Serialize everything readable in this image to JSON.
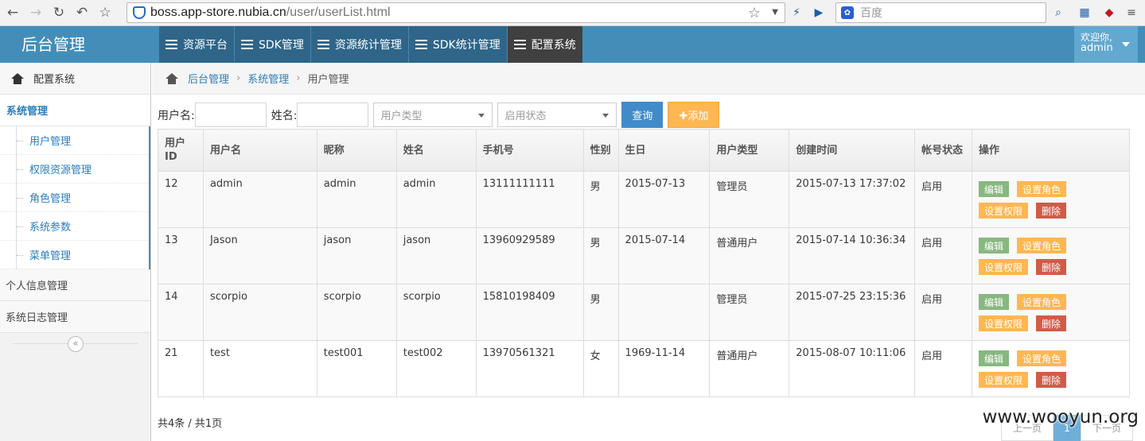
{
  "browser": {
    "url_host": "boss.app-store.nubia.cn",
    "url_path": "/user/userList.html",
    "search_placeholder": "百度"
  },
  "header": {
    "brand": "后台管理",
    "nav": [
      "资源平台",
      "SDK管理",
      "资源统计管理",
      "SDK统计管理",
      "配置系统"
    ],
    "active_nav": "配置系统",
    "welcome": "欢迎你,",
    "username": "admin"
  },
  "sidebar": {
    "header": "配置系统",
    "group": "系统管理",
    "sub_items": [
      "用户管理",
      "权限资源管理",
      "角色管理",
      "系统参数",
      "菜单管理"
    ],
    "items": [
      "个人信息管理",
      "系统日志管理"
    ],
    "collapse_icon": "«"
  },
  "breadcrumb": {
    "home": "后台管理",
    "section": "系统管理",
    "current": "用户管理"
  },
  "filter": {
    "username_label": "用户名:",
    "name_label": "姓名:",
    "user_type_placeholder": "用户类型",
    "status_placeholder": "启用状态",
    "search_button": "查询",
    "add_button": "✚添加"
  },
  "table": {
    "columns": [
      "用户ID",
      "用户名",
      "昵称",
      "姓名",
      "手机号",
      "性别",
      "生日",
      "用户类型",
      "创建时间",
      "帐号状态",
      "操作"
    ],
    "rows": [
      {
        "id": "12",
        "username": "admin",
        "nickname": "admin",
        "name": "admin",
        "phone": "13111111111",
        "gender": "男",
        "birthday": "2015-07-13",
        "type": "管理员",
        "created": "2015-07-13 17:37:02",
        "status": "启用"
      },
      {
        "id": "13",
        "username": "Jason",
        "nickname": "jason",
        "name": "jason",
        "phone": "13960929589",
        "gender": "男",
        "birthday": "2015-07-14",
        "type": "普通用户",
        "created": "2015-07-14 10:36:34",
        "status": "启用"
      },
      {
        "id": "14",
        "username": "scorpio",
        "nickname": "scorpio",
        "name": "scorpio",
        "phone": "15810198409",
        "gender": "男",
        "birthday": "",
        "type": "管理员",
        "created": "2015-07-25 23:15:36",
        "status": "启用"
      },
      {
        "id": "21",
        "username": "test",
        "nickname": "test001",
        "name": "test002",
        "phone": "13970561321",
        "gender": "女",
        "birthday": "1969-11-14",
        "type": "普通用户",
        "created": "2015-08-07 10:11:06",
        "status": "启用"
      }
    ],
    "actions": {
      "edit": "编辑",
      "set_role": "设置角色",
      "set_perm": "设置权限",
      "delete": "删除"
    }
  },
  "pagination": {
    "summary": "共4条 / 共1页",
    "prev": "上一页",
    "current": "1",
    "next": "下一页"
  },
  "watermark": "www.wooyun.org"
}
